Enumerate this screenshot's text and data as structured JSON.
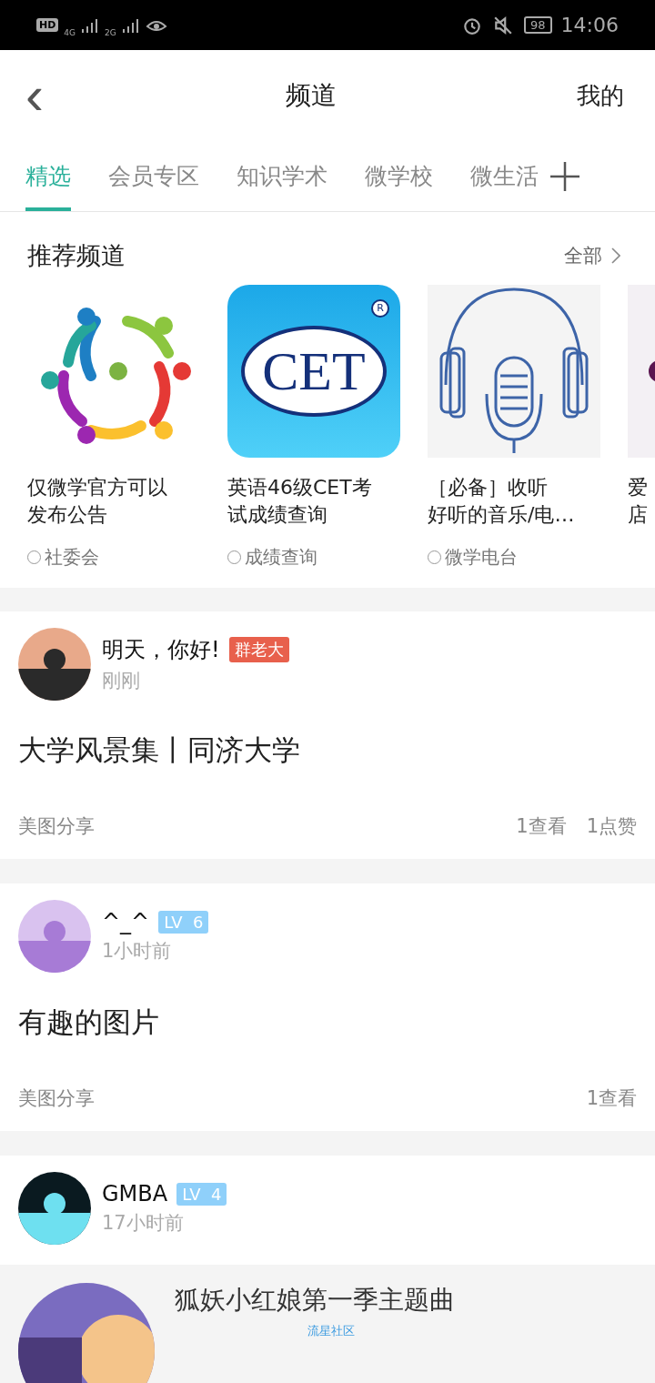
{
  "status_bar": {
    "hd": "HD",
    "net1": "4G",
    "net2": "2G",
    "battery": "98",
    "time": "14:06"
  },
  "nav": {
    "back": "‹",
    "title": "频道",
    "mine": "我的"
  },
  "tabs": [
    {
      "label": "精选",
      "selected": true
    },
    {
      "label": "会员专区",
      "selected": false
    },
    {
      "label": "知识学术",
      "selected": false
    },
    {
      "label": "微学校",
      "selected": false
    },
    {
      "label": "微生活",
      "selected": false
    }
  ],
  "recommended": {
    "title": "推荐频道",
    "more": "全部",
    "channels": [
      {
        "kind": "people",
        "title_lines": [
          "仅微学官方可以",
          "发布公告"
        ],
        "tag": "社委会"
      },
      {
        "kind": "cet",
        "logo_text": "CET",
        "logo_mark": "R",
        "title_lines": [
          "英语46级CET考",
          "试成绩查询"
        ],
        "tag": "成绩查询"
      },
      {
        "kind": "headphones",
        "title_lines": [
          "［必备］收听",
          "好听的音乐/电…"
        ],
        "tag": "微学电台"
      },
      {
        "kind": "picture",
        "title_lines": [
          "爱",
          "店"
        ]
      }
    ]
  },
  "posts": [
    {
      "author": "明天，你好!",
      "badge": {
        "kind": "role",
        "text": "群老大"
      },
      "time": "刚刚",
      "title": "大学风景集丨同济大学",
      "category": "美图分享",
      "stats": [
        "1查看",
        "1点赞"
      ]
    },
    {
      "author": "^_^",
      "badge": {
        "kind": "level",
        "text": "LV  6"
      },
      "time": "1小时前",
      "title": "有趣的图片",
      "category": "美图分享",
      "stats": [
        "1查看"
      ]
    },
    {
      "author": "GMBA",
      "badge": {
        "kind": "level",
        "text": "LV  4"
      },
      "time": "17小时前",
      "share": {
        "title": "狐妖小红娘第一季主题曲",
        "source": "流星社区"
      }
    }
  ]
}
